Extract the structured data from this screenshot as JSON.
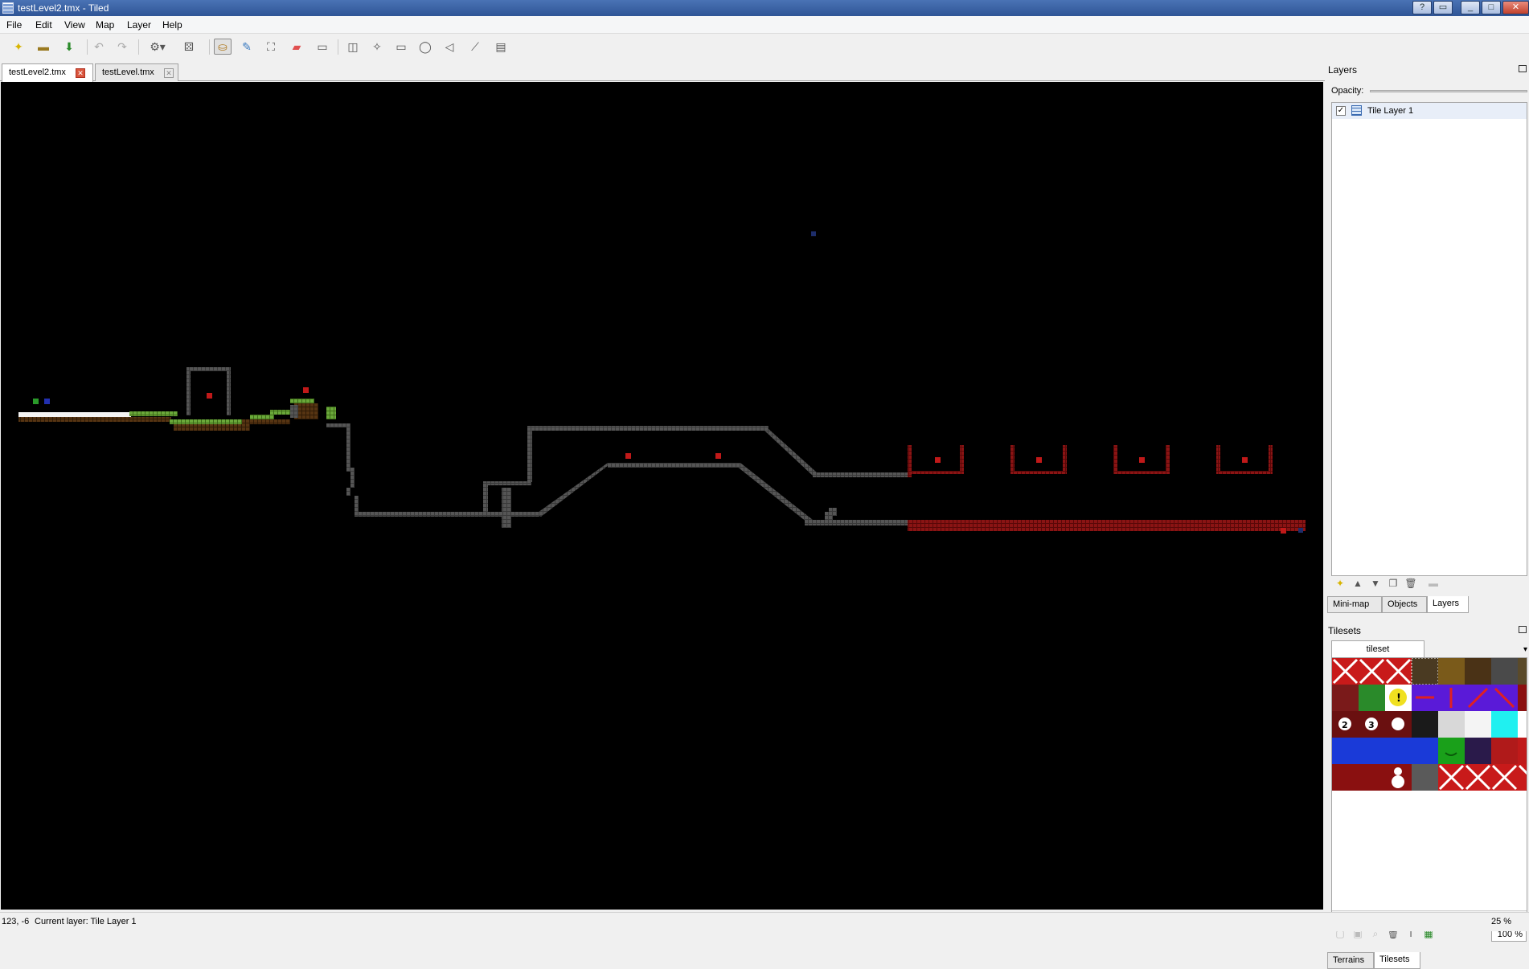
{
  "window": {
    "title": "testLevel2.tmx - Tiled"
  },
  "menu": {
    "items": [
      "File",
      "Edit",
      "View",
      "Map",
      "Layer",
      "Help"
    ]
  },
  "toolbar": {
    "buttons": [
      "new-file-icon",
      "open-file-icon",
      "save-icon",
      "undo-icon",
      "redo-icon",
      "commands-icon",
      "random-icon",
      "stamp-brush-icon",
      "terrain-brush-icon",
      "bucket-fill-icon",
      "eraser-icon",
      "rect-select-icon",
      "magic-wand-icon",
      "select-same-icon",
      "insert-rectangle-icon",
      "insert-ellipse-icon",
      "insert-polygon-icon",
      "insert-polyline-icon",
      "insert-tile-icon"
    ],
    "active": "stamp-brush-icon"
  },
  "tabs": [
    {
      "label": "testLevel2.tmx",
      "active": true
    },
    {
      "label": "testLevel.tmx",
      "active": false
    }
  ],
  "layers_panel": {
    "title": "Layers",
    "opacity_label": "Opacity:",
    "layers": [
      {
        "name": "Tile Layer 1",
        "visible": true
      }
    ]
  },
  "dock_tabs_top": [
    {
      "label": "Mini-map",
      "active": false
    },
    {
      "label": "Objects",
      "active": false
    },
    {
      "label": "Layers",
      "active": true
    }
  ],
  "tilesets_panel": {
    "title": "Tilesets",
    "tileset_tab": "tileset",
    "zoom": "100 %"
  },
  "dock_tabs_bottom": [
    {
      "label": "Terrains",
      "active": false
    },
    {
      "label": "Tilesets",
      "active": true
    }
  ],
  "status": {
    "coords": "123, -6",
    "current_layer": "Current layer: Tile Layer 1",
    "zoom": "25 %"
  },
  "colors": {
    "canvas_bg": "#000000",
    "wall": "#4a4a4a",
    "lava": "#7a0f0f",
    "grass": "#5a9a2a",
    "dirt": "#4a2e10",
    "accent_red": "#c0191b"
  }
}
